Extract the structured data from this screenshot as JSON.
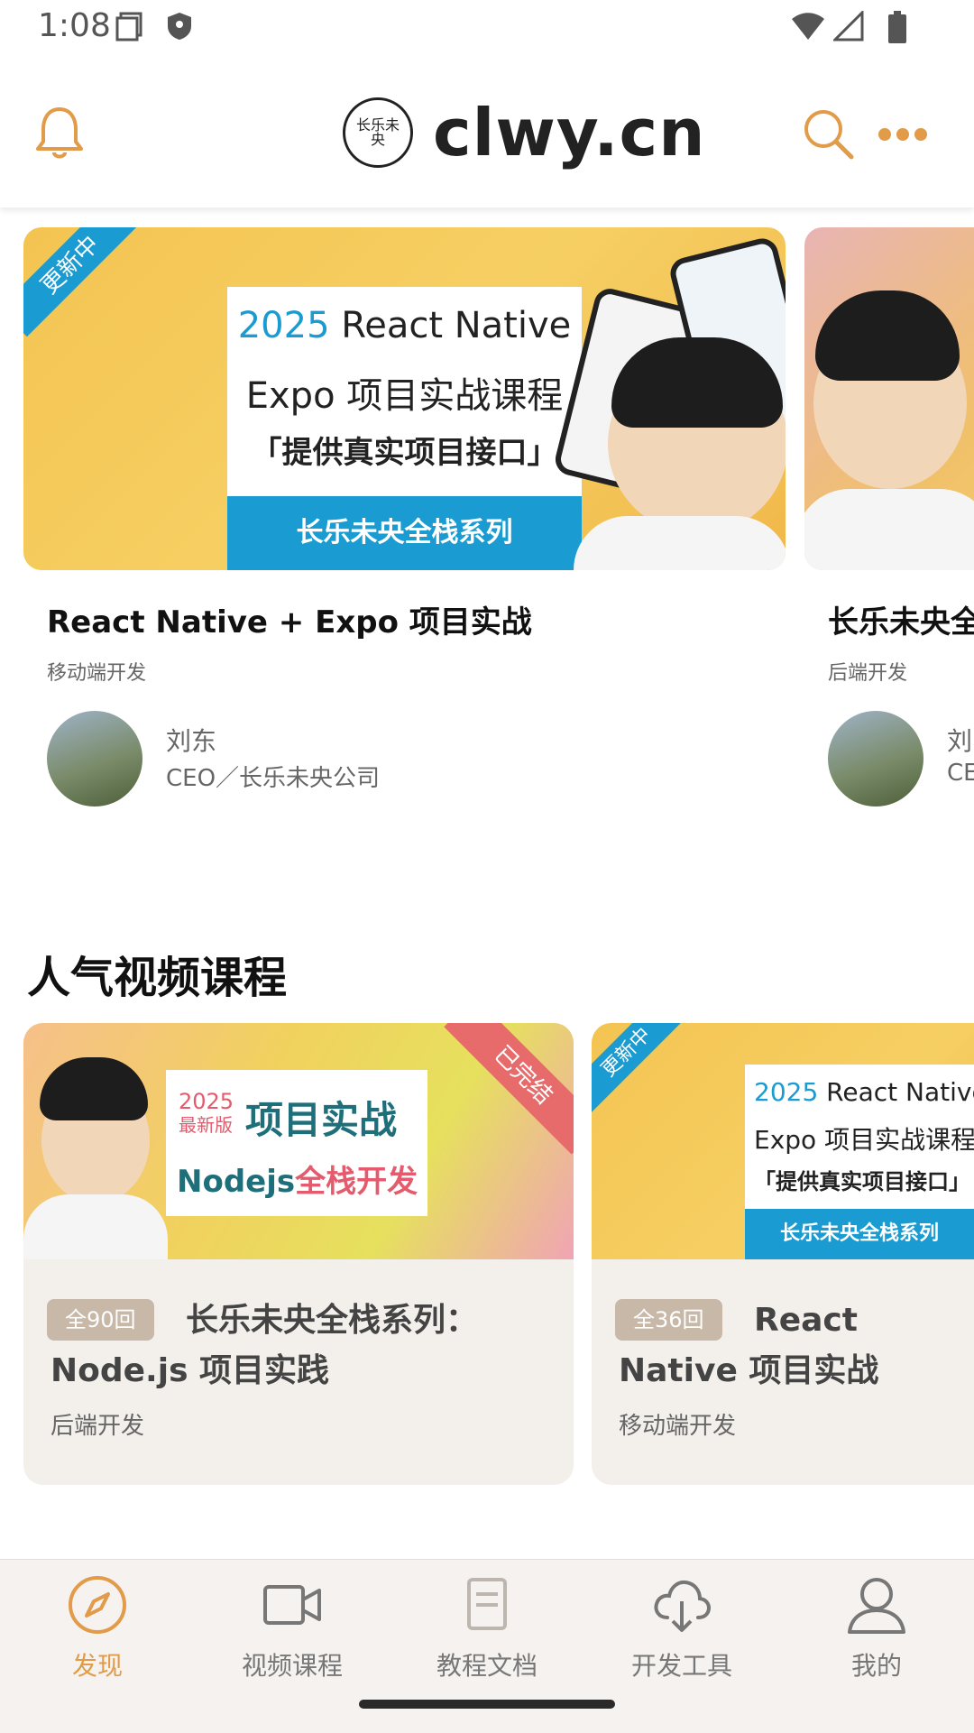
{
  "status_bar": {
    "time": "1:08"
  },
  "header": {
    "logo_text": "clwy.cn",
    "logo_seal": "长乐未央"
  },
  "featured": [
    {
      "ribbon": "更新中",
      "banner_year": "2025",
      "banner_line1": "React Native",
      "banner_line2": "Expo 项目实战课程",
      "banner_line3": "「提供真实项目接口」",
      "banner_footer": "长乐未央全栈系列",
      "title": "React Native + Expo 项目实战",
      "category": "移动端开发",
      "author_name": "刘东",
      "author_role": "CEO／长乐未央公司"
    },
    {
      "title": "长乐未央全",
      "category": "后端开发",
      "author_name": "刘东",
      "author_role": "CEO"
    }
  ],
  "section": {
    "title": "人气视频课程"
  },
  "videos": [
    {
      "ribbon": "已完结",
      "banner_year": "2025",
      "banner_sub": "最新版",
      "banner_title": "项目实战",
      "banner_node": "Nodejs",
      "banner_rest": "全栈开发",
      "badge": "全90回",
      "title": "长乐未央全栈系列：Node.js 项目实践",
      "category": "后端开发"
    },
    {
      "ribbon": "更新中",
      "banner_year": "2025",
      "banner_line1": "React Native",
      "banner_line2": "Expo 项目实战课程",
      "banner_line3": "「提供真实项目接口」",
      "banner_footer": "长乐未央全栈系列",
      "badge": "全36回",
      "title": "React Native 项目实战",
      "category": "移动端开发"
    }
  ],
  "tabs": [
    {
      "label": "发现",
      "icon": "compass-icon",
      "active": true
    },
    {
      "label": "视频课程",
      "icon": "video-camera-icon"
    },
    {
      "label": "教程文档",
      "icon": "document-icon"
    },
    {
      "label": "开发工具",
      "icon": "cloud-download-icon"
    },
    {
      "label": "我的",
      "icon": "user-icon"
    }
  ],
  "colors": {
    "accent": "#e29b48",
    "ribbon_blue": "#1a9bd1",
    "ribbon_red": "#e86b6b"
  }
}
